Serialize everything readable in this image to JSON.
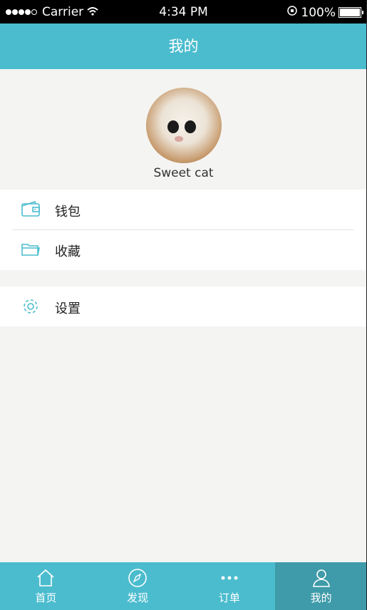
{
  "status_bar": {
    "carrier": "Carrier",
    "time": "4:34 PM",
    "battery": "100%"
  },
  "nav": {
    "title": "我的"
  },
  "profile": {
    "username": "Sweet cat"
  },
  "menu": {
    "group1": [
      {
        "label": "钱包",
        "icon": "wallet-icon"
      },
      {
        "label": "收藏",
        "icon": "folder-icon"
      }
    ],
    "group2": [
      {
        "label": "设置",
        "icon": "gear-icon"
      }
    ]
  },
  "tabs": [
    {
      "label": "首页",
      "icon": "home-icon"
    },
    {
      "label": "发现",
      "icon": "compass-icon"
    },
    {
      "label": "订单",
      "icon": "more-icon"
    },
    {
      "label": "我的",
      "icon": "user-icon",
      "active": true
    }
  ],
  "colors": {
    "accent": "#4bbcce",
    "active_tab": "#3f9ba9",
    "icon": "#4bbcce"
  }
}
